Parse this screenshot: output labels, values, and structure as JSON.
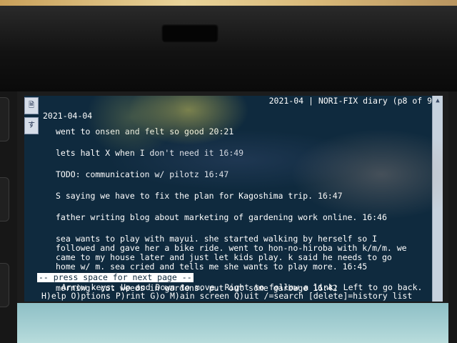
{
  "header": {
    "title": "2021-04 | NORI-FIX diary (p8 of 9)"
  },
  "side_tabs": [
    {
      "glyph": "🗎"
    },
    {
      "glyph": "す"
    }
  ],
  "date_heading": "2021-04-04",
  "entries": [
    "went to onsen and felt so good 20:21",
    "lets halt X when I don't need it 16:49",
    "TODO: communication w/ pilotz 16:47",
    "S saying we have to fix the plan for Kagoshima trip. 16:47",
    "father writing blog about marketing of gardening work online. 16:46",
    "sea wants to play with mayui. she started walking by herself so I\nfollowed and gave her a bike ride. went to hon-no-hiroba with k/m/m. we\ncame to my house later and just let kids play. k said he needs to go\nhome w/ m. sea cried and tells me she wants to play more. 16:45",
    "morning- cut weeds in gardens. put out some garbage 16:42"
  ],
  "pager_prompt": "-- press space for next page --",
  "help_line_1": "Arrow keys: Up and Down to move.  Right to follow a link; Left to go back.",
  "help_line_2": "H)elp O)ptions P)rint G)o M)ain screen Q)uit /=search [delete]=history list",
  "scrollbar": {
    "up_icon": "▲",
    "down_icon": "▼"
  }
}
